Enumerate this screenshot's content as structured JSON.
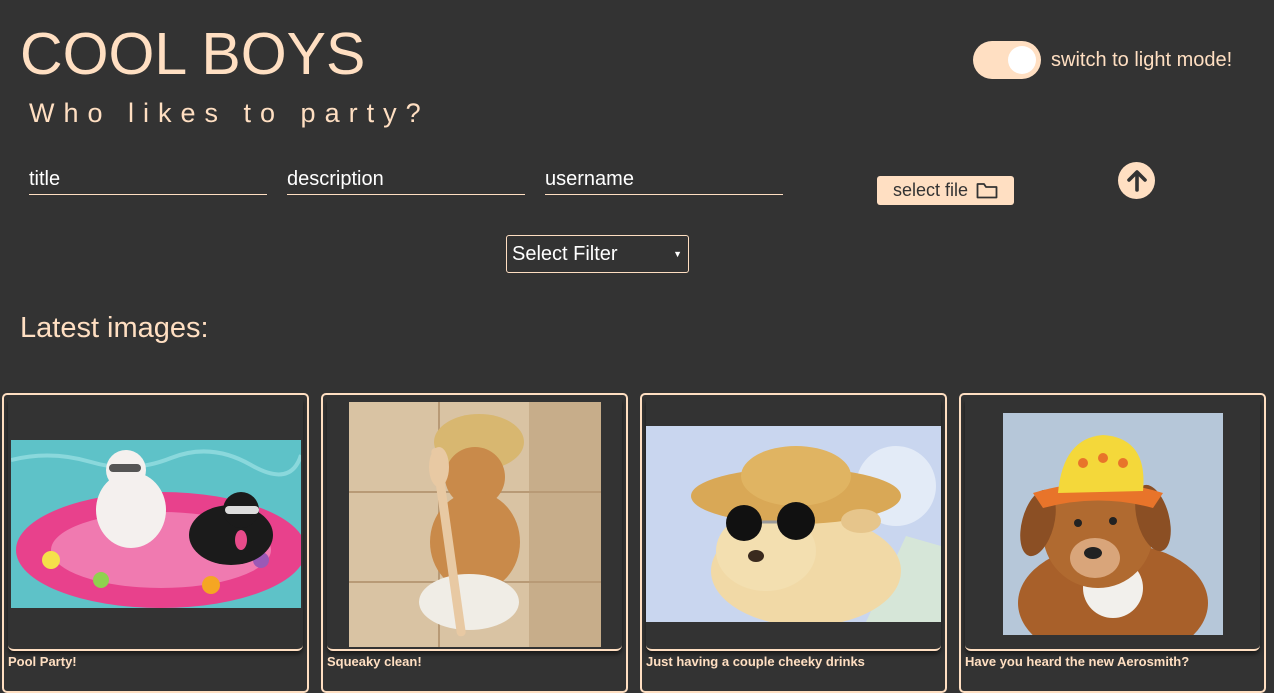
{
  "header": {
    "title": "COOL BOYS",
    "tagline": "Who likes to party?"
  },
  "theme_toggle": {
    "label": "switch to light mode!",
    "state": "on"
  },
  "upload_form": {
    "title_placeholder": "title",
    "description_placeholder": "description",
    "username_placeholder": "username",
    "file_button_label": "select file",
    "file_icon": "folder-icon",
    "submit_icon": "arrow-up-icon"
  },
  "filter": {
    "selected": "Select Filter"
  },
  "gallery": {
    "heading": "Latest images:",
    "cards": [
      {
        "caption": "Pool Party!"
      },
      {
        "caption": "Squeaky clean!"
      },
      {
        "caption": "Just having a couple cheeky drinks"
      },
      {
        "caption": "Have you heard the new Aerosmith?"
      }
    ]
  },
  "colors": {
    "background": "#333333",
    "accent": "#ffdfc2"
  }
}
